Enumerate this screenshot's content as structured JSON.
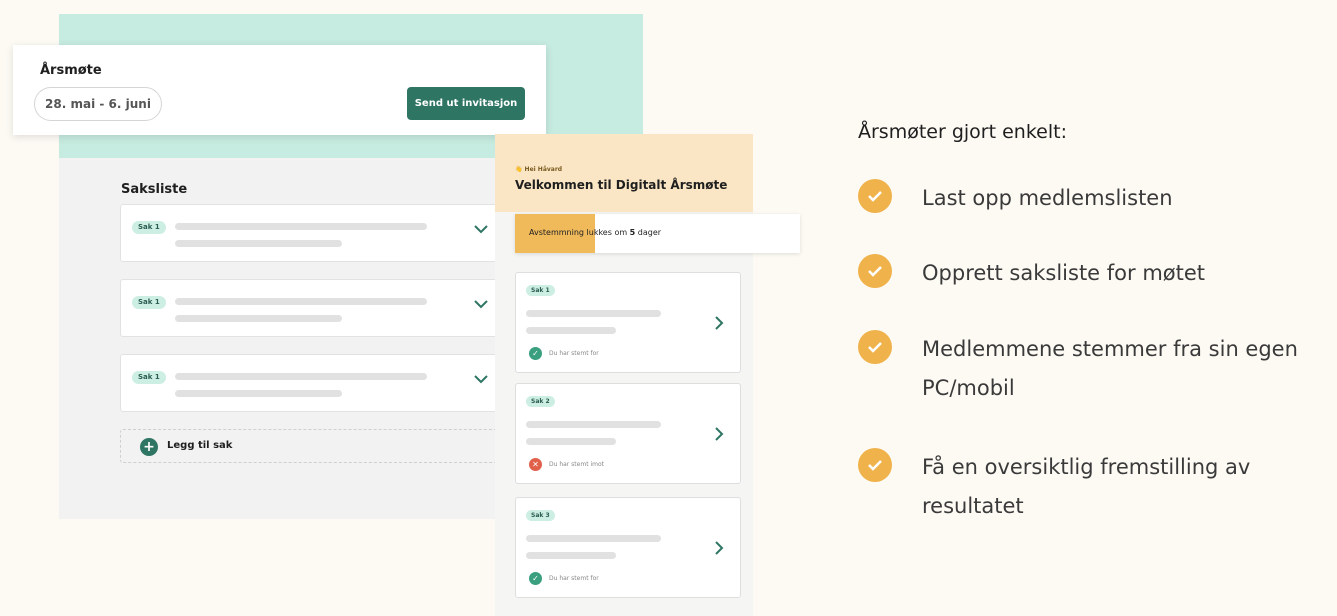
{
  "admin": {
    "title": "Årsmøte",
    "date_range": "28. mai - 6. juni",
    "send_button": "Send ut invitasjon",
    "agenda_title": "Saksliste",
    "items": [
      {
        "tag": "Sak 1"
      },
      {
        "tag": "Sak 1"
      },
      {
        "tag": "Sak 1"
      }
    ],
    "add_label": "Legg til sak"
  },
  "mobile": {
    "greeting": "👋 Hei Håvard",
    "welcome": "Velkommen til Digitalt Årsmøte",
    "vote_prefix": "Avstemmning lukkes om ",
    "vote_days": "5",
    "vote_suffix": " dager",
    "vote_progress_percent": 28,
    "cards": [
      {
        "tag": "Sak 1",
        "status": "Du har stemt for",
        "status_type": "for",
        "status_color": "#3a9f7f"
      },
      {
        "tag": "Sak 2",
        "status": "Du har stemt imot",
        "status_type": "imot",
        "status_color": "#e0604a"
      },
      {
        "tag": "Sak 3",
        "status": "Du har stemt for",
        "status_type": "for",
        "status_color": "#3a9f7f"
      }
    ]
  },
  "features": {
    "title": "Årsmøter gjort enkelt:",
    "items": [
      "Last opp medlemslisten",
      "Opprett saksliste for møtet",
      "Medlemmene stemmer fra sin egen PC/mobil",
      "Få en oversiktlig fremstilling av resultatet"
    ]
  },
  "colors": {
    "teal": "#c6ebe0",
    "brand_green": "#2f7563",
    "accent_orange": "#f0b24a",
    "peach": "#fae6c4"
  }
}
